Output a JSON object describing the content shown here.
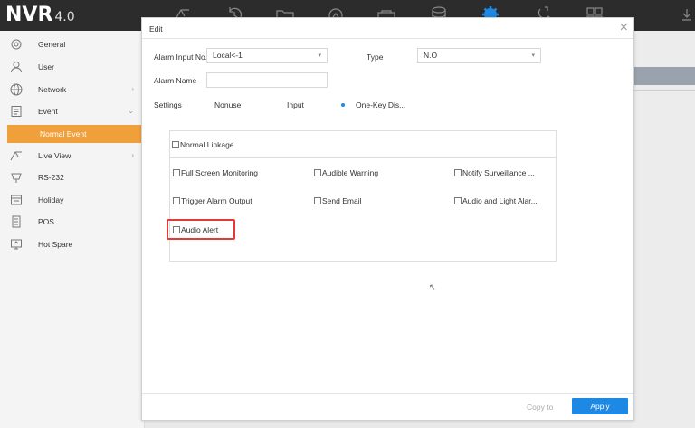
{
  "app": {
    "logo": "NVR",
    "version": "4.0"
  },
  "top_icons": [
    "live-view-icon",
    "playback-icon",
    "folder-icon",
    "smart-icon",
    "camera-icon",
    "storage-icon",
    "settings-gear-icon",
    "maintenance-icon",
    "layout-icon"
  ],
  "sidebar": {
    "items": [
      {
        "label": "General",
        "icon": "gear-icon"
      },
      {
        "label": "User",
        "icon": "user-icon"
      },
      {
        "label": "Network",
        "icon": "globe-icon",
        "arrow": "›"
      },
      {
        "label": "Event",
        "icon": "event-icon",
        "arrow": "⌄"
      },
      {
        "label": "Normal Event"
      },
      {
        "label": "Live View",
        "icon": "live-view-icon",
        "arrow": "›"
      },
      {
        "label": "RS-232",
        "icon": "rs232-icon"
      },
      {
        "label": "Holiday",
        "icon": "holiday-icon"
      },
      {
        "label": "POS",
        "icon": "pos-icon"
      },
      {
        "label": "Hot Spare",
        "icon": "hot-spare-icon"
      }
    ]
  },
  "dialog": {
    "title": "Edit",
    "close": "×",
    "alarm_input_label": "Alarm Input No.",
    "alarm_input_value": "Local<-1",
    "type_label": "Type",
    "type_value": "N.O",
    "alarm_name_label": "Alarm Name",
    "alarm_name_value": "",
    "settings_label": "Settings",
    "settings_options": [
      {
        "label": "Nonuse",
        "selected": false
      },
      {
        "label": "Input",
        "selected": false
      },
      {
        "label": "One-Key Dis...",
        "selected": true
      }
    ],
    "linkage": {
      "normal_linkage": "Normal Linkage",
      "full_screen": "Full Screen Monitoring",
      "audible_warning": "Audible Warning",
      "notify_surveillance": "Notify Surveillance ...",
      "trigger_alarm_output": "Trigger Alarm Output",
      "send_email": "Send Email",
      "audio_light_alarm": "Audio and Light Alar...",
      "audio_alert": "Audio Alert"
    },
    "copy_to": "Copy to",
    "apply": "Apply"
  },
  "colors": {
    "accent": "#1e88e5",
    "sidebar_active": "#f0a03a",
    "highlight": "#e53935",
    "topbar": "#2c2c2c"
  }
}
